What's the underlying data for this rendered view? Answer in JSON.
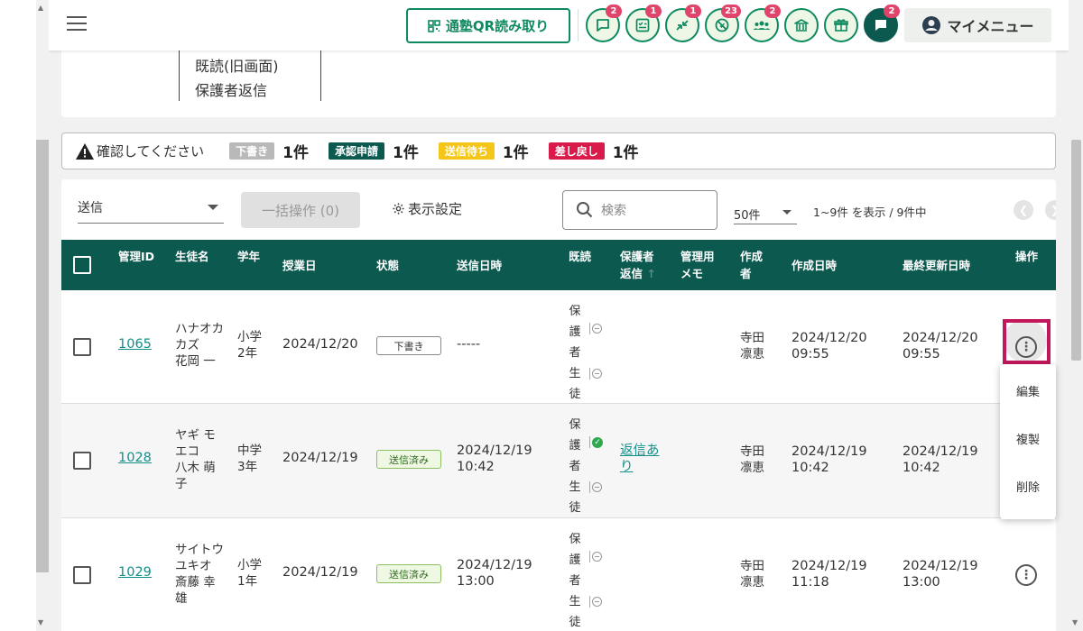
{
  "topbar": {
    "qr_label": "通塾QR読み取り",
    "icons": [
      {
        "name": "chat-bubble-icon",
        "badge": "2"
      },
      {
        "name": "checklist-icon",
        "badge": "1"
      },
      {
        "name": "swap-arrows-icon",
        "badge": "1"
      },
      {
        "name": "no-entry-icon",
        "badge": "23"
      },
      {
        "name": "group-icon",
        "badge": "2"
      },
      {
        "name": "school-building-icon",
        "badge": ""
      },
      {
        "name": "gift-icon",
        "badge": ""
      },
      {
        "name": "message-icon",
        "badge": "2"
      }
    ],
    "my_menu": "マイメニュー"
  },
  "top_card": {
    "line1": "既読(旧画面)",
    "line2": "保護者返信"
  },
  "status_bar": {
    "warning": "確認してください",
    "items": [
      {
        "tag": "下書き",
        "count": "1件",
        "color": "#b9b9b9",
        "text_color": "#ffffff"
      },
      {
        "tag": "承認申請",
        "count": "1件",
        "color": "#0c5a4f",
        "text_color": "#ffffff"
      },
      {
        "tag": "送信待ち",
        "count": "1件",
        "color": "#f5c518",
        "text_color": "#ffffff"
      },
      {
        "tag": "差し戻し",
        "count": "1件",
        "color": "#d81b4a",
        "text_color": "#ffffff"
      }
    ]
  },
  "toolbar": {
    "send_select": "送信",
    "bulk_action": "一括操作 (0)",
    "display_settings": "表示設定",
    "search_placeholder": "検索",
    "per_page": "50件",
    "range_text": "1~9件 を表示 / 9件中"
  },
  "table": {
    "headers": {
      "id": "管理ID",
      "name": "生徒名",
      "grade": "学年",
      "class_date": "授業日",
      "status": "状態",
      "sent_at": "送信日時",
      "read": "既読",
      "guardian_reply_1": "保護者",
      "guardian_reply_2": "返信",
      "memo_1": "管理用",
      "memo_2": "メモ",
      "author_1": "作成",
      "author_2": "者",
      "created_at": "作成日時",
      "updated_at": "最終更新日時",
      "actions": "操作"
    },
    "read_labels": [
      "保",
      "護",
      "者",
      "生",
      "徒"
    ],
    "rows": [
      {
        "id": "1065",
        "name_kana_1": "ハナオカ",
        "name_kana_2": "カズ",
        "name": "花岡 一",
        "grade_1": "小学",
        "grade_2": "2年",
        "class_date": "2024/12/20",
        "status": "下書き",
        "sent_date": "-----",
        "sent_time": "",
        "reply": "",
        "author_1": "寺田",
        "author_2": "凛恵",
        "created_date": "2024/12/20",
        "created_time": "09:55",
        "updated_date": "2024/12/20",
        "updated_time": "09:55"
      },
      {
        "id": "1028",
        "name_kana_1": "ヤギ モ",
        "name_kana_2": "エコ",
        "name": "八木 萌",
        "name_2": "子",
        "grade_1": "中学",
        "grade_2": "3年",
        "class_date": "2024/12/19",
        "status": "送信済み",
        "sent_date": "2024/12/19",
        "sent_time": "10:42",
        "reply_1": "返信あ",
        "reply_2": "り",
        "author_1": "寺田",
        "author_2": "凛恵",
        "created_date": "2024/12/19",
        "created_time": "10:42",
        "updated_date": "2024/12/19",
        "updated_time": "10:42"
      },
      {
        "id": "1029",
        "name_kana_1": "サイトウ",
        "name_kana_2": "ユキオ",
        "name": "斎藤 幸",
        "name_2": "雄",
        "grade_1": "小学",
        "grade_2": "1年",
        "class_date": "2024/12/19",
        "status": "送信済み",
        "sent_date": "2024/12/19",
        "sent_time": "13:00",
        "reply": "",
        "author_1": "寺田",
        "author_2": "凛恵",
        "created_date": "2024/12/19",
        "created_time": "11:18",
        "updated_date": "2024/12/19",
        "updated_time": "13:00"
      }
    ]
  },
  "action_menu": {
    "edit": "編集",
    "copy": "複製",
    "delete": "削除"
  },
  "colors": {
    "brand_green": "#0c5a4f",
    "accent_green": "#0f8a5f",
    "highlight": "#c2185b",
    "link": "#138f8b"
  }
}
